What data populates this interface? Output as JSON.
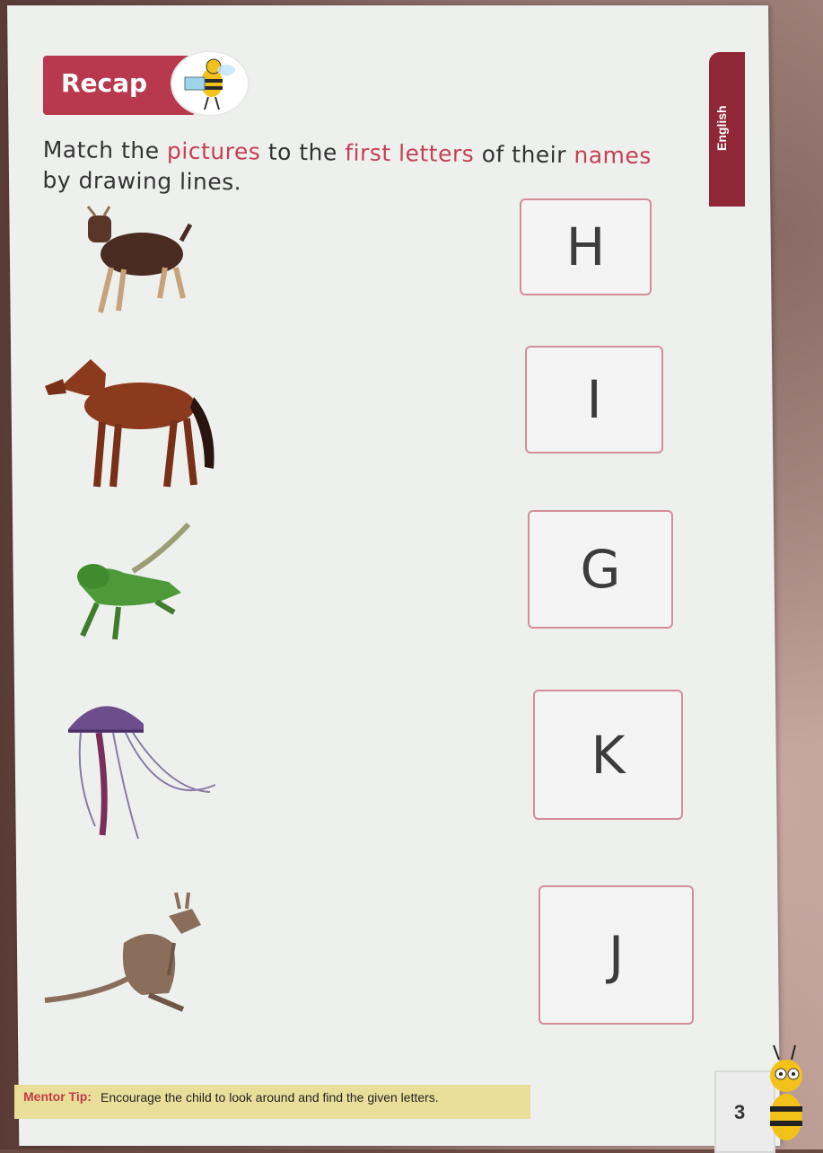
{
  "header": {
    "banner_label": "Recap",
    "side_tab": "English"
  },
  "instructions": {
    "part1": "Match the ",
    "accent1": "pictures",
    "part2": " to the ",
    "accent2": "first letters",
    "part3": " of their ",
    "accent3": "names",
    "line2": "by drawing lines."
  },
  "animals": [
    {
      "name": "goat-image"
    },
    {
      "name": "horse-image"
    },
    {
      "name": "iguana-image"
    },
    {
      "name": "jellyfish-image"
    },
    {
      "name": "kangaroo-image"
    }
  ],
  "letters": [
    "H",
    "I",
    "G",
    "K",
    "J"
  ],
  "footer": {
    "tip_label": "Mentor Tip:",
    "tip_text": "Encourage the child to look around and find the given letters.",
    "page_number": "3"
  },
  "colors": {
    "banner": "#b8384d",
    "accent_text": "#c44155",
    "side_tab": "#8f2736",
    "box_border": "#d38e9a",
    "tip_bg": "#eadf9a"
  }
}
